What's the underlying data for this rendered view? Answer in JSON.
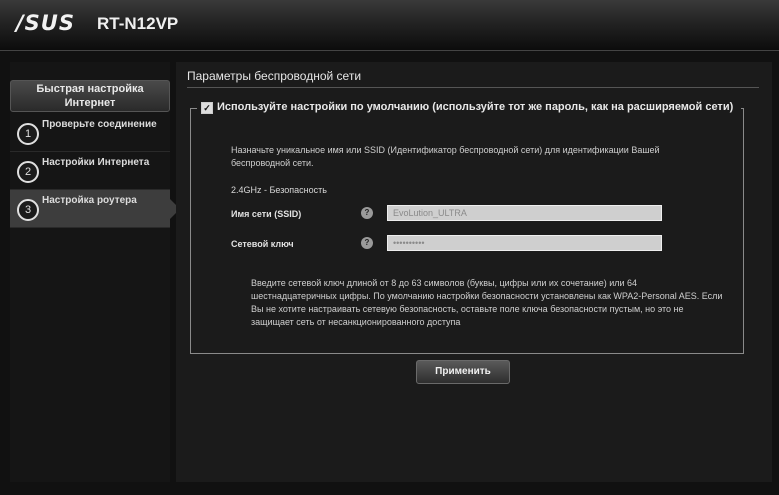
{
  "header": {
    "logo": "/SUS",
    "model": "RT-N12VP"
  },
  "sidebar": {
    "title": "Быстрая настройка Интернет",
    "steps": [
      {
        "num": "1",
        "label": "Проверьте соединение"
      },
      {
        "num": "2",
        "label": "Настройки Интернета"
      },
      {
        "num": "3",
        "label": "Настройка роутера"
      }
    ]
  },
  "main": {
    "title": "Параметры беспроводной сети",
    "use_default_label": "Используйте настройки по умолчанию (используйте тот же пароль, как на расширяемой сети)",
    "description": "Назначьте уникальное имя или SSID (Идентификатор беспроводной сети) для идентификации Вашей беспроводной сети.",
    "band_label": "2.4GHz - Безопасность",
    "ssid_label": "Имя сети (SSID)",
    "ssid_value": "EvoLution_ULTRA",
    "key_label": "Сетевой ключ",
    "key_value": "••••••••••",
    "help_symbol": "?",
    "note": "Введите сетевой ключ длиной от 8 до 63 символов (буквы, цифры или их сочетание) или 64 шестнадцатеричных цифры. По умолчанию настройки безопасности установлены как WPA2-Personal AES. Если Вы не хотите настраивать сетевую безопасность, оставьте поле ключа безопасности пустым, но это не защищает сеть от несанкционированного доступа",
    "apply_label": "Применить"
  }
}
